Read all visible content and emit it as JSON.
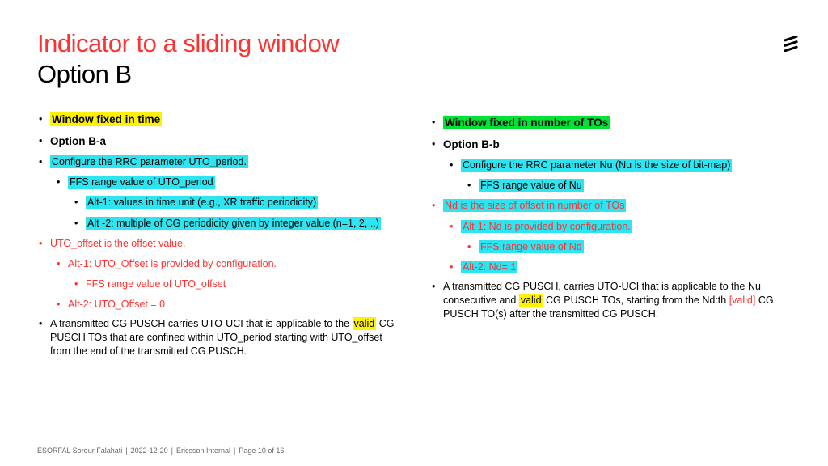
{
  "title": "Indicator to a sliding window",
  "subtitle": "Option B",
  "left": {
    "h1": "Window fixed in time",
    "h2": "Option B-a",
    "c1": "Configure the RRC parameter UTO_period.",
    "c2": "FFS range value of UTO_period",
    "c3": "Alt-1: values in time unit (e.g., XR traffic periodicity)",
    "c4": "Alt -2: multiple of CG periodicity given by integer value (n=1, 2, ..)",
    "r1": "UTO_offset is the offset value.",
    "r2": "Alt-1: UTO_Offset is provided by configuration.",
    "r3": "FFS range value of UTO_offset",
    "r4": "Alt-2: UTO_Offset = 0",
    "p1a": "A transmitted CG PUSCH carries UTO-UCI that is applicable to the ",
    "p1b": "valid",
    "p1c": " CG PUSCH TOs that are confined within UTO_period starting with UTO_offset from the end of the transmitted CG PUSCH."
  },
  "right": {
    "h1": "Window fixed in number of TOs",
    "h2": "Option B-b",
    "c1": "Configure the RRC parameter Nu (Nu is the size of bit-map)",
    "c2": "FFS range value of Nu",
    "r1": "Nd is the size of offset in number of TOs",
    "r2": "Alt-1: Nd is provided by configuration.",
    "r3": "FFS range value of Nd",
    "r4": "Alt-2: Nd= 1",
    "p1a": "A transmitted CG PUSCH, carries UTO-UCI that is applicable to the Nu consecutive and ",
    "p1b": "valid",
    "p1c": " CG PUSCH TOs, starting from the Nd:th ",
    "p1d": "[valid]",
    "p1e": " CG PUSCH TO(s) after the transmitted CG PUSCH."
  },
  "footer": {
    "author": "ESORFAL Sorour Falahati",
    "date": "2022-12-20",
    "cls": "Ericsson Internal",
    "page": "Page 10 of 16"
  }
}
